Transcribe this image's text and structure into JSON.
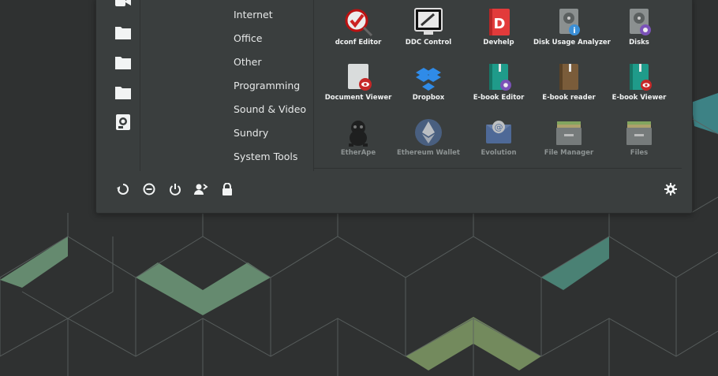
{
  "theme": {
    "menu_bg": "#3a3e3e",
    "text": "#e6e8e8",
    "wallpaper_bg": "#2f3131",
    "hex_accent_green": "#6e9a7a",
    "hex_accent_teal": "#3f8c8f",
    "hex_accent_olive": "#7f9a65"
  },
  "favorites": [
    {
      "icon": "video-camera-icon"
    },
    {
      "icon": "folder-icon"
    },
    {
      "icon": "folder-icon"
    },
    {
      "icon": "folder-icon"
    },
    {
      "icon": "harddisk-icon"
    }
  ],
  "categories": [
    "Internet",
    "Office",
    "Other",
    "Programming",
    "Sound & Video",
    "Sundry",
    "System Tools"
  ],
  "apps": [
    {
      "label": "dconf Editor",
      "icon": "dconf-editor-icon"
    },
    {
      "label": "DDC Control",
      "icon": "ddc-control-icon"
    },
    {
      "label": "Devhelp",
      "icon": "devhelp-icon"
    },
    {
      "label": "Disk Usage Analyzer",
      "icon": "disk-usage-analyzer-icon"
    },
    {
      "label": "Disks",
      "icon": "disks-icon"
    },
    {
      "label": "Document Viewer",
      "icon": "document-viewer-icon"
    },
    {
      "label": "Dropbox",
      "icon": "dropbox-icon"
    },
    {
      "label": "E-book Editor",
      "icon": "ebook-editor-icon"
    },
    {
      "label": "E-book reader",
      "icon": "ebook-reader-icon"
    },
    {
      "label": "E-book Viewer",
      "icon": "ebook-viewer-icon"
    },
    {
      "label": "EtherApe",
      "icon": "etherape-icon"
    },
    {
      "label": "Ethereum Wallet",
      "icon": "ethereum-wallet-icon"
    },
    {
      "label": "Evolution",
      "icon": "evolution-icon"
    },
    {
      "label": "File Manager",
      "icon": "file-manager-icon"
    },
    {
      "label": "Files",
      "icon": "files-icon"
    }
  ],
  "bottom_bar": {
    "left": [
      "restart-icon",
      "suspend-icon",
      "shutdown-icon",
      "switch-user-icon",
      "lock-icon"
    ],
    "right": [
      "settings-gear-icon"
    ]
  }
}
